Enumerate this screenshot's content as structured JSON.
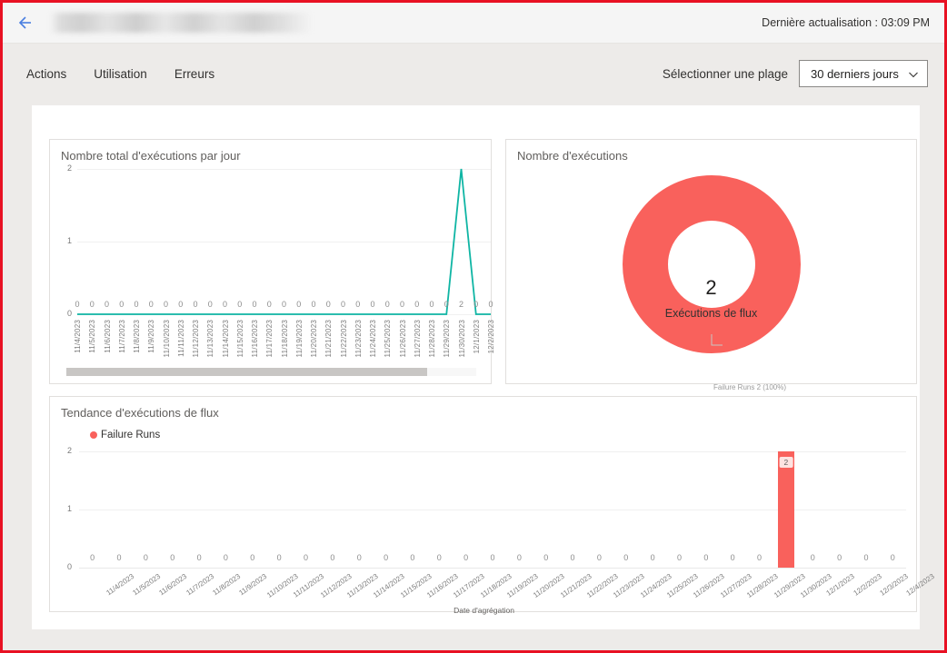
{
  "header": {
    "back_icon": "arrow-left-icon",
    "title": "",
    "last_refresh": "Dernière actualisation : 03:09 PM"
  },
  "commandbar": {
    "tabs": [
      {
        "label": "Actions"
      },
      {
        "label": "Utilisation"
      },
      {
        "label": "Erreurs"
      }
    ],
    "range_label": "Sélectionner une plage",
    "range_value": "30 derniers jours",
    "chevron_icon": "chevron-down-icon"
  },
  "colors": {
    "line": "#0FB5A4",
    "fail": "#F9615C",
    "badge_bg": "#FDE3E1",
    "page_bg": "#EDEBE9",
    "accent_border": "#E81123"
  },
  "panels": {
    "daily_runs": {
      "title": "Nombre total d'exécutions par jour"
    },
    "run_count": {
      "title": "Nombre d'exécutions",
      "center_value": "2",
      "center_label": "Exécutions de flux",
      "callout": "Failure Runs 2 (100%)"
    },
    "trend": {
      "title": "Tendance d'exécutions de flux",
      "legend": "Failure Runs"
    }
  },
  "chart_data": [
    {
      "id": "daily_runs",
      "type": "line",
      "title": "Nombre total d'exécutions par jour",
      "xlabel": "",
      "ylabel": "",
      "ylim": [
        0,
        2
      ],
      "yticks": [
        0,
        1,
        2
      ],
      "grid": true,
      "legend": "none",
      "line_color": "#0FB5A4",
      "scrollable": true,
      "categories": [
        "11/4/2023",
        "11/5/2023",
        "11/6/2023",
        "11/7/2023",
        "11/8/2023",
        "11/9/2023",
        "11/10/2023",
        "11/11/2023",
        "11/12/2023",
        "11/13/2023",
        "11/14/2023",
        "11/15/2023",
        "11/16/2023",
        "11/17/2023",
        "11/18/2023",
        "11/19/2023",
        "11/20/2023",
        "11/21/2023",
        "11/22/2023",
        "11/23/2023",
        "11/24/2023",
        "11/25/2023",
        "11/26/2023",
        "11/27/2023",
        "11/28/2023",
        "11/29/2023",
        "11/30/2023",
        "12/1/2023",
        "12/2/2023"
      ],
      "values": [
        0,
        0,
        0,
        0,
        0,
        0,
        0,
        0,
        0,
        0,
        0,
        0,
        0,
        0,
        0,
        0,
        0,
        0,
        0,
        0,
        0,
        0,
        0,
        0,
        0,
        0,
        2,
        0,
        0
      ],
      "point_labels": [
        "0",
        "0",
        "0",
        "0",
        "0",
        "0",
        "0",
        "0",
        "0",
        "0",
        "0",
        "0",
        "0",
        "0",
        "0",
        "0",
        "0",
        "0",
        "0",
        "0",
        "0",
        "0",
        "0",
        "0",
        "0",
        "0",
        "2",
        "0",
        "0"
      ]
    },
    {
      "id": "run_count",
      "type": "pie",
      "title": "Nombre d'exécutions",
      "donut": true,
      "center_value": "2",
      "center_label": "Exécutions de flux",
      "slices": [
        {
          "name": "Failure Runs",
          "value": 2,
          "percent": 100,
          "color": "#F9615C",
          "label": "Failure Runs 2 (100%)"
        }
      ]
    },
    {
      "id": "trend",
      "type": "bar",
      "title": "Tendance d'exécutions de flux",
      "xlabel": "Date d'agrégation",
      "ylabel": "",
      "ylim": [
        0,
        2
      ],
      "yticks": [
        0,
        1,
        2
      ],
      "grid": true,
      "legend_position": "top-left",
      "series": [
        {
          "name": "Failure Runs",
          "color": "#F9615C",
          "values": [
            0,
            0,
            0,
            0,
            0,
            0,
            0,
            0,
            0,
            0,
            0,
            0,
            0,
            0,
            0,
            0,
            0,
            0,
            0,
            0,
            0,
            0,
            0,
            0,
            0,
            0,
            2,
            0,
            0,
            0,
            0
          ]
        }
      ],
      "categories": [
        "11/4/2023",
        "11/5/2023",
        "11/6/2023",
        "11/7/2023",
        "11/8/2023",
        "11/9/2023",
        "11/10/2023",
        "11/11/2023",
        "11/12/2023",
        "11/13/2023",
        "11/14/2023",
        "11/15/2023",
        "11/16/2023",
        "11/17/2023",
        "11/18/2023",
        "11/19/2023",
        "11/20/2023",
        "11/21/2023",
        "11/22/2023",
        "11/23/2023",
        "11/24/2023",
        "11/25/2023",
        "11/26/2023",
        "11/27/2023",
        "11/28/2023",
        "11/29/2023",
        "11/30/2023",
        "12/1/2023",
        "12/2/2023",
        "12/3/2023",
        "12/4/2023"
      ],
      "bar_labels": [
        "0",
        "0",
        "0",
        "0",
        "0",
        "0",
        "0",
        "0",
        "0",
        "0",
        "0",
        "0",
        "0",
        "0",
        "0",
        "0",
        "0",
        "0",
        "0",
        "0",
        "0",
        "0",
        "0",
        "0",
        "0",
        "0",
        "2",
        "0",
        "0",
        "0",
        "0"
      ]
    }
  ]
}
